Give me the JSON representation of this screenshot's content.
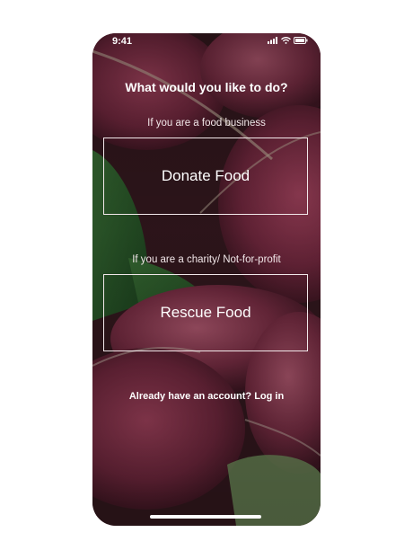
{
  "status_bar": {
    "time": "9:41",
    "icons": [
      "signal-icon",
      "wifi-icon",
      "battery-icon"
    ]
  },
  "screen": {
    "heading": "What would you like to do?",
    "business_prompt": "If you are a food business",
    "donate_label": "Donate Food",
    "charity_prompt": "If you are a charity/ Not-for-profit",
    "rescue_label": "Rescue Food",
    "login_text": "Already have an account? Log in"
  },
  "colors": {
    "text": "#ffffff",
    "button_border": "#f2e8ea",
    "overlay": "#5b2a33"
  }
}
